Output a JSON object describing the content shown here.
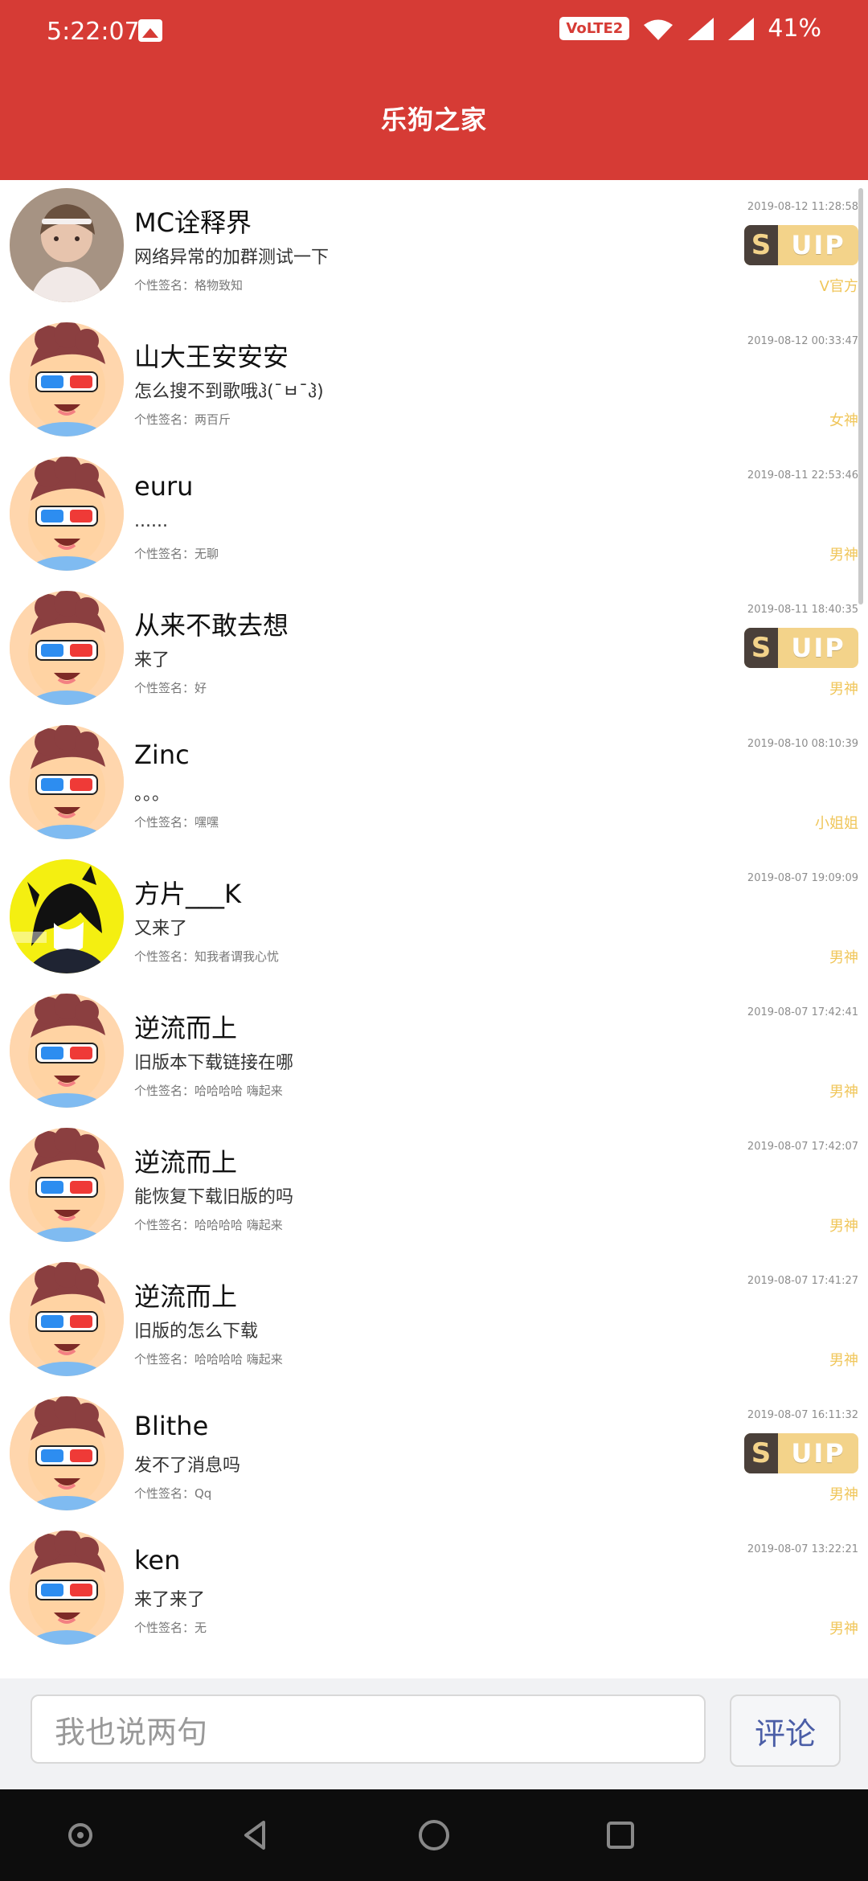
{
  "status": {
    "time": "5:22:07",
    "volte": "VoLTE2",
    "battery": "41%"
  },
  "header": {
    "title": "乐狗之家"
  },
  "comments": [
    {
      "name": "MC诠释界",
      "message": "网络异常的加群测试一下",
      "signature": "个性签名：格物致知",
      "time": "2019-08-12 11:28:58",
      "role": "V官方",
      "vip": "UIP",
      "avatar": "girl-photo"
    },
    {
      "name": "山大王安安安",
      "message": "怎么搜不到歌哦ჰ(¯ㅂ¯ჰ)",
      "signature": "个性签名：两百斤",
      "time": "2019-08-12 00:33:47",
      "role": "女神",
      "avatar": "cartoon-boy"
    },
    {
      "name": "euru",
      "message": "......",
      "signature": "个性签名：无聊",
      "time": "2019-08-11 22:53:46",
      "role": "男神",
      "avatar": "cartoon-boy"
    },
    {
      "name": "从来不敢去想",
      "message": "来了",
      "signature": "个性签名：好",
      "time": "2019-08-11 18:40:35",
      "role": "男神",
      "vip": "UIP",
      "avatar": "cartoon-boy"
    },
    {
      "name": "Zinc",
      "message": "。。。",
      "signature": "个性签名：嘿嘿",
      "time": "2019-08-10 08:10:39",
      "role": "小姐姐",
      "avatar": "cartoon-boy"
    },
    {
      "name": "方片___K",
      "message": "又来了",
      "signature": "个性签名：知我者谓我心忧",
      "time": "2019-08-07 19:09:09",
      "role": "男神",
      "avatar": "anime-boy"
    },
    {
      "name": "逆流而上",
      "message": "旧版本下载链接在哪",
      "signature": "个性签名：哈哈哈哈 嗨起来",
      "time": "2019-08-07 17:42:41",
      "role": "男神",
      "avatar": "cartoon-boy"
    },
    {
      "name": "逆流而上",
      "message": "能恢复下载旧版的吗",
      "signature": "个性签名：哈哈哈哈 嗨起来",
      "time": "2019-08-07 17:42:07",
      "role": "男神",
      "avatar": "cartoon-boy"
    },
    {
      "name": "逆流而上",
      "message": "旧版的怎么下载",
      "signature": "个性签名：哈哈哈哈 嗨起来",
      "time": "2019-08-07 17:41:27",
      "role": "男神",
      "avatar": "cartoon-boy"
    },
    {
      "name": "Blithe",
      "message": "发不了消息吗",
      "signature": "个性签名：Qq",
      "time": "2019-08-07 16:11:32",
      "role": "男神",
      "vip": "UIP",
      "avatar": "cartoon-boy"
    },
    {
      "name": "ken",
      "message": "来了来了",
      "signature": "个性签名：无",
      "time": "2019-08-07 13:22:21",
      "role": "男神",
      "avatar": "cartoon-boy"
    }
  ],
  "composer": {
    "placeholder": "我也说两句",
    "button": "评论"
  },
  "colors": {
    "brand": "#d63b35",
    "vip_gold": "#f3d38a",
    "role_gold": "#f0c65a"
  }
}
